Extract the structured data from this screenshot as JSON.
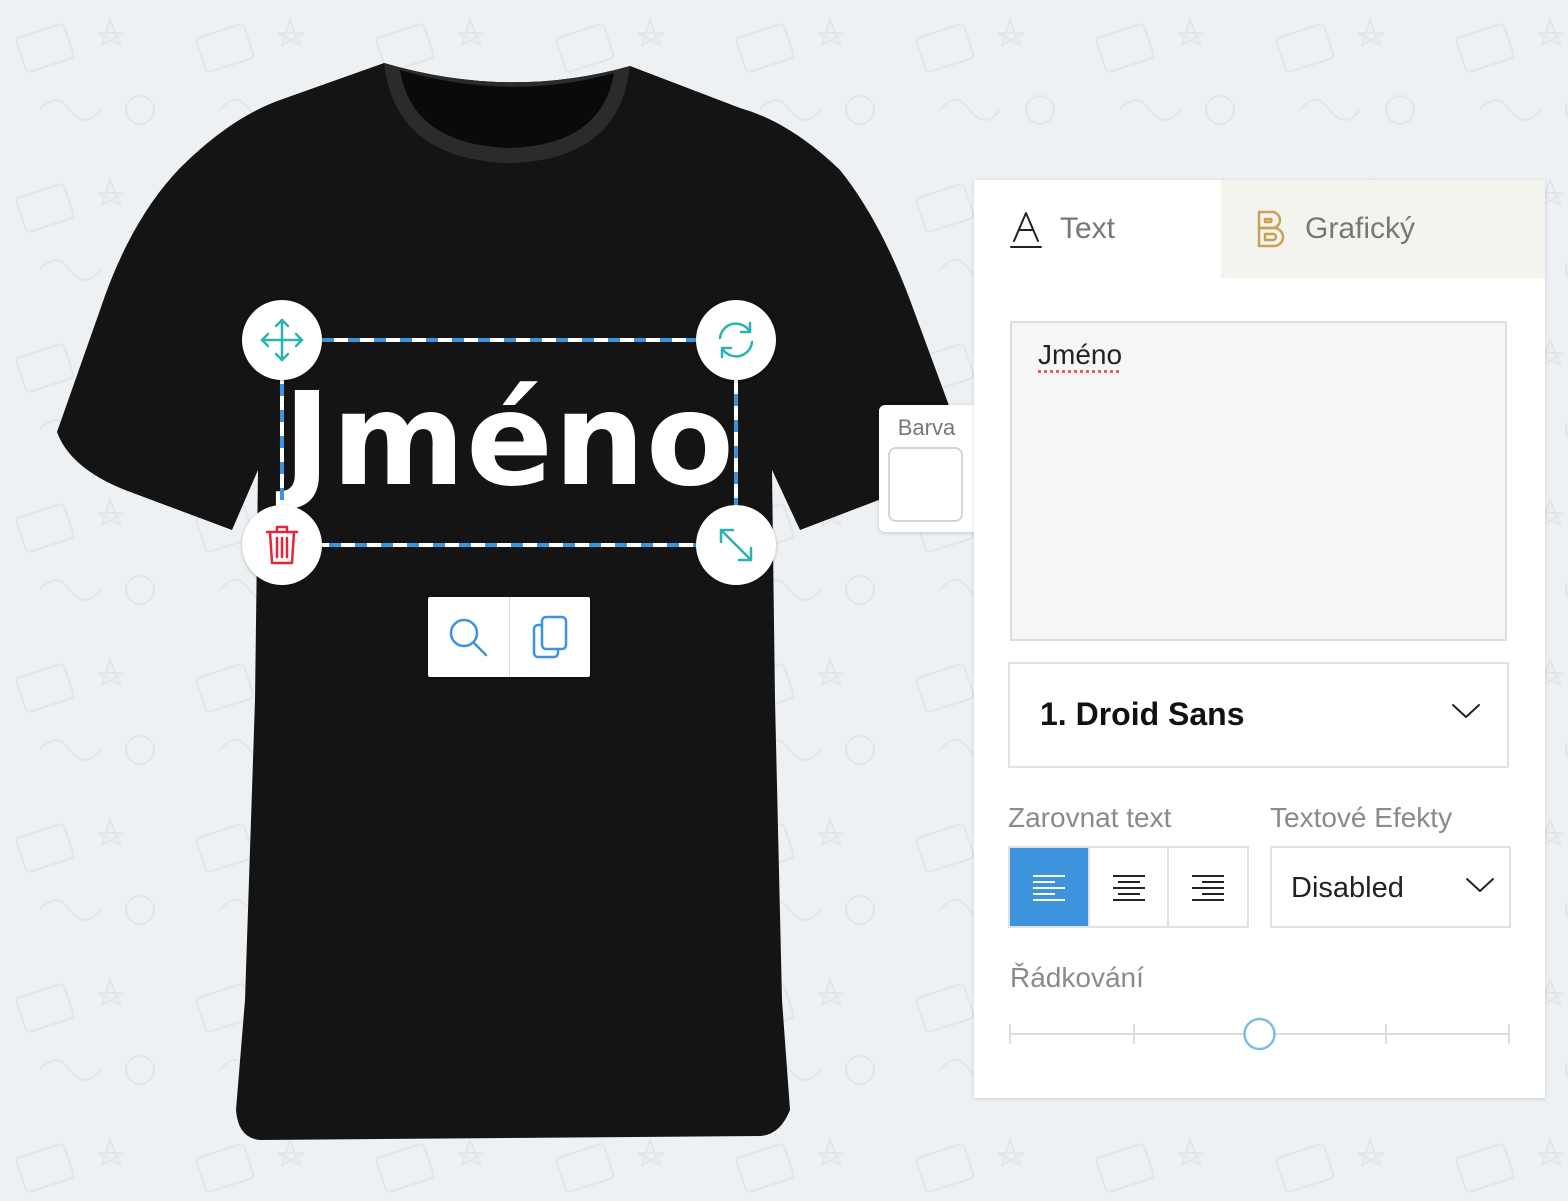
{
  "design": {
    "text": "Jméno",
    "text_color": "#ffffff",
    "shirt_color": "#141414"
  },
  "canvas_controls": {
    "move": "move-icon",
    "rotate": "rotate-icon",
    "delete": "trash-icon",
    "resize": "resize-icon",
    "zoom": "magnifier-icon",
    "duplicate": "copy-icon"
  },
  "color_picker": {
    "label": "Barva",
    "value": "#ffffff"
  },
  "tabs": [
    {
      "label": "Text",
      "icon": "text-a-icon",
      "active": true
    },
    {
      "label": "Grafický",
      "icon": "graphic-b-icon",
      "active": false
    }
  ],
  "text_input": {
    "value": "Jméno"
  },
  "font": {
    "selected": "1. Droid Sans"
  },
  "alignment": {
    "label": "Zarovnat text",
    "options": [
      "left",
      "center",
      "right"
    ],
    "selected": "left"
  },
  "effects": {
    "label": "Textové Efekty",
    "selected": "Disabled"
  },
  "line_spacing": {
    "label": "Řádkování",
    "value_fraction": 0.5
  },
  "colors": {
    "accent": "#3d94dd",
    "teal": "#2bb3b1",
    "delete_red": "#e0283a",
    "tab_graphic_bg": "#f4f4ef",
    "gold": "#c9a055"
  }
}
